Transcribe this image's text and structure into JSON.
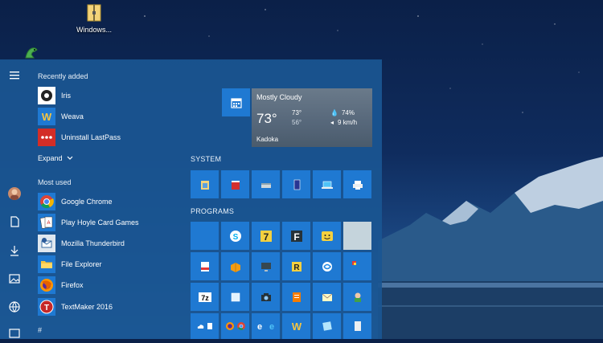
{
  "desktop": {
    "icons": [
      {
        "label": "Windows..."
      }
    ]
  },
  "start_menu": {
    "recently_added": {
      "heading": "Recently added",
      "items": [
        {
          "name": "Iris",
          "icon": "iris-icon"
        },
        {
          "name": "Weava",
          "icon": "weava-icon"
        },
        {
          "name": "Uninstall LastPass",
          "icon": "lastpass-icon"
        }
      ],
      "expand_label": "Expand"
    },
    "most_used": {
      "heading": "Most used",
      "items": [
        {
          "name": "Google Chrome",
          "icon": "chrome-icon"
        },
        {
          "name": "Play Hoyle Card Games",
          "icon": "cards-icon"
        },
        {
          "name": "Mozilla Thunderbird",
          "icon": "thunderbird-icon"
        },
        {
          "name": "File Explorer",
          "icon": "folder-icon"
        },
        {
          "name": "Firefox",
          "icon": "firefox-icon"
        },
        {
          "name": "TextMaker 2016",
          "icon": "textmaker-icon"
        }
      ]
    },
    "letter_header": "#",
    "groups": {
      "system": "SYSTEM",
      "programs": "PROGRAMS"
    },
    "weather": {
      "condition": "Mostly Cloudy",
      "temp": "73°",
      "high": "73°",
      "low": "56°",
      "humidity": "74%",
      "wind": "9 km/h",
      "city": "Kadoka"
    }
  },
  "colors": {
    "tile": "#1f79d2",
    "menu_bg": "#1a5692"
  }
}
